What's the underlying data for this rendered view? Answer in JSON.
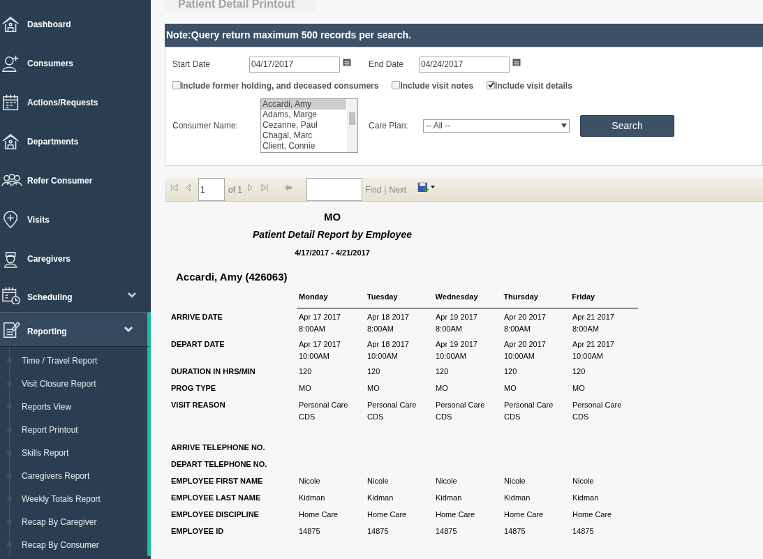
{
  "sidebar": {
    "items": [
      {
        "label": "Dashboard"
      },
      {
        "label": "Consumers"
      },
      {
        "label": "Actions/Requests"
      },
      {
        "label": "Departments"
      },
      {
        "label": "Refer Consumer"
      },
      {
        "label": "Visits"
      },
      {
        "label": "Caregivers"
      },
      {
        "label": "Scheduling",
        "expanded": false
      },
      {
        "label": "Reporting",
        "expanded": true,
        "children": [
          {
            "label": "Time / Travel Report"
          },
          {
            "label": "Visit Closure Report"
          },
          {
            "label": "Reports View"
          },
          {
            "label": "Report Printout"
          },
          {
            "label": "Skills Report"
          },
          {
            "label": "Caregivers Report"
          },
          {
            "label": "Weekly Totals Report"
          },
          {
            "label": "Recap By Caregiver"
          },
          {
            "label": "Recap By Consumer"
          }
        ]
      }
    ]
  },
  "page_title": "Patient Detail Printout",
  "note": "Note:Query return maximum 500 records per search.",
  "form": {
    "start_date_label": "Start Date",
    "start_date": "04/17/2017",
    "end_date_label": "End Date",
    "end_date": "04/24/2017",
    "checkboxes": [
      {
        "label": "Include former holding, and deceased consumers",
        "checked": false
      },
      {
        "label": "Include visit notes",
        "checked": false
      },
      {
        "label": "Include visit details",
        "checked": true
      }
    ],
    "consumer_label": "Consumer Name:",
    "consumers": [
      {
        "label": "Accardi, Amy",
        "selected": true
      },
      {
        "label": "Adams, Marge",
        "selected": false
      },
      {
        "label": "Cezanne, Paul",
        "selected": false
      },
      {
        "label": "Chagal, Marc",
        "selected": false
      },
      {
        "label": "Client, Connie",
        "selected": false
      }
    ],
    "care_plan_label": "Care Plan:",
    "care_plan": "-- All --",
    "search_button": "Search"
  },
  "toolbar": {
    "page": "1",
    "of": "of 1",
    "find": "Find",
    "separator": "|",
    "next": "Next"
  },
  "report": {
    "title": "MO",
    "subtitle": "Patient Detail Report by Employee",
    "range": "4/17/2017 - 4/21/2017",
    "consumer": "Accardi, Amy (426063)",
    "columns": [
      "Monday",
      "Tuesday",
      "Wednesday",
      "Thursday",
      "Friday"
    ],
    "rows": [
      {
        "label": "ARRIVE DATE",
        "cells": [
          [
            "Apr 17 2017",
            "8:00AM"
          ],
          [
            "Apr 18 2017",
            "8:00AM"
          ],
          [
            "Apr 19 2017",
            "8:00AM"
          ],
          [
            "Apr 20 2017",
            "8:00AM"
          ],
          [
            "Apr 21 2017",
            "8:00AM"
          ]
        ]
      },
      {
        "label": "DEPART DATE",
        "cells": [
          [
            "Apr 17 2017",
            "10:00AM"
          ],
          [
            "Apr 18 2017",
            "10:00AM"
          ],
          [
            "Apr 19 2017",
            "10:00AM"
          ],
          [
            "Apr 20 2017",
            "10:00AM"
          ],
          [
            "Apr 21 2017",
            "10:00AM"
          ]
        ]
      },
      {
        "label": "DURATION IN HRS/MIN",
        "cells": [
          [
            "120"
          ],
          [
            "120"
          ],
          [
            "120"
          ],
          [
            "120"
          ],
          [
            "120"
          ]
        ]
      },
      {
        "label": "PROG TYPE",
        "cells": [
          [
            "MO"
          ],
          [
            "MO"
          ],
          [
            "MO"
          ],
          [
            "MO"
          ],
          [
            "MO"
          ]
        ]
      },
      {
        "label": "VISIT REASON",
        "cells": [
          [
            "Personal Care",
            "CDS"
          ],
          [
            "Personal Care",
            "CDS"
          ],
          [
            "Personal Care",
            "CDS"
          ],
          [
            "Personal Care",
            "CDS"
          ],
          [
            "Personal Care",
            "CDS"
          ]
        ]
      },
      {
        "label": "ARRIVE TELEPHONE NO.",
        "cells": []
      },
      {
        "label": "DEPART TELEPHONE NO.",
        "cells": []
      },
      {
        "label": "EMPLOYEE FIRST NAME",
        "cells": [
          [
            "Nicole"
          ],
          [
            "Nicole"
          ],
          [
            "Nicole"
          ],
          [
            "Nicole"
          ],
          [
            "Nicole"
          ]
        ]
      },
      {
        "label": "EMPLOYEE LAST NAME",
        "cells": [
          [
            "Kidman"
          ],
          [
            "Kidman"
          ],
          [
            "Kidman"
          ],
          [
            "Kidman"
          ],
          [
            "Kidman"
          ]
        ]
      },
      {
        "label": "EMPLOYEE DISCIPLINE",
        "cells": [
          [
            "Home Care"
          ],
          [
            "Home Care"
          ],
          [
            "Home Care"
          ],
          [
            "Home Care"
          ],
          [
            "Home Care"
          ]
        ]
      },
      {
        "label": "EMPLOYEE ID",
        "cells": [
          [
            "14875"
          ],
          [
            "14875"
          ],
          [
            "14875"
          ],
          [
            "14875"
          ],
          [
            "14875"
          ]
        ]
      }
    ]
  }
}
